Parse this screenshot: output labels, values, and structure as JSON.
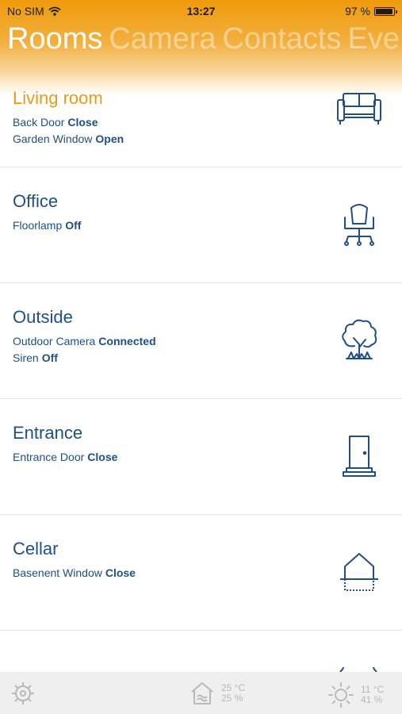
{
  "status_bar": {
    "carrier": "No SIM",
    "time": "13:27",
    "battery": "97 %",
    "battery_level": 0.97
  },
  "tabs": [
    "Rooms",
    "Camera",
    "Contacts",
    "Eve"
  ],
  "rooms": [
    {
      "name": "Living room",
      "icon": "sofa-icon",
      "items": [
        {
          "label": "Back Door",
          "value": "Close"
        },
        {
          "label": "Garden Window",
          "value": "Open"
        }
      ]
    },
    {
      "name": "Office",
      "icon": "office-chair-icon",
      "items": [
        {
          "label": "Floorlamp",
          "value": "Off"
        }
      ]
    },
    {
      "name": "Outside",
      "icon": "tree-icon",
      "items": [
        {
          "label": "Outdoor Camera",
          "value": "Connected"
        },
        {
          "label": "Siren",
          "value": "Off"
        }
      ]
    },
    {
      "name": "Entrance",
      "icon": "door-icon",
      "items": [
        {
          "label": "Entrance Door",
          "value": "Close"
        }
      ]
    },
    {
      "name": "Cellar",
      "icon": "cellar-icon",
      "items": [
        {
          "label": "Basenent Window",
          "value": "Close"
        }
      ]
    }
  ],
  "bottom_bar": {
    "indoor": {
      "temperature": "25 °C",
      "humidity": "25 %"
    },
    "outdoor": {
      "temperature": "11 °C",
      "humidity": "41 %"
    }
  },
  "colors": {
    "accent": "#e99a1d",
    "header_orange": "#ef9a0b",
    "text_blue": "#1f4f86",
    "divider": "#e6e6e6",
    "bottom_bar": "#efefef"
  }
}
